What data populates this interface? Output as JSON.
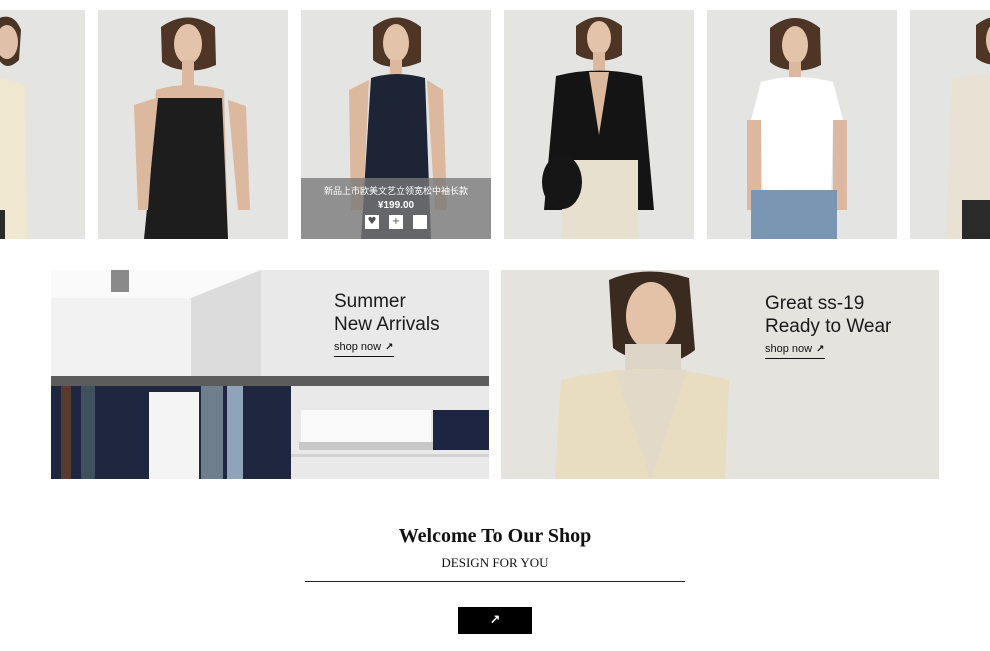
{
  "products": [
    {
      "image": "cream-cardigan-partial"
    },
    {
      "image": "black-leather-slip-dress"
    },
    {
      "image": "navy-ribbed-tank",
      "overlay": {
        "title": "新品上市欧美文艺立领宽松中袖长款",
        "price": "¥199.00",
        "actions": [
          {
            "icon": "heart-icon",
            "glyph": "♥"
          },
          {
            "icon": "plus-icon",
            "glyph": "+"
          },
          {
            "icon": "cart-icon",
            "glyph": "🛒"
          }
        ]
      }
    },
    {
      "image": "black-v-neck-cardigan"
    },
    {
      "image": "white-tee-jeans"
    },
    {
      "image": "beige-knit-partial"
    }
  ],
  "banners": [
    {
      "line1": "Summer",
      "line2": "New Arrivals",
      "link": "shop now",
      "arrow": "↗",
      "image": "store-clothing-rack"
    },
    {
      "line1": "Great ss-19",
      "line2": "Ready to Wear",
      "link": "shop now",
      "arrow": "↗",
      "image": "model-cream-cardigan"
    }
  ],
  "welcome": {
    "title": "Welcome To Our Shop",
    "subtitle": "DESIGN FOR YOU",
    "button_arrow": "↗"
  },
  "colors": {
    "product_bg": "#e4e4e3",
    "overlay": "#787878",
    "button": "#000000"
  }
}
